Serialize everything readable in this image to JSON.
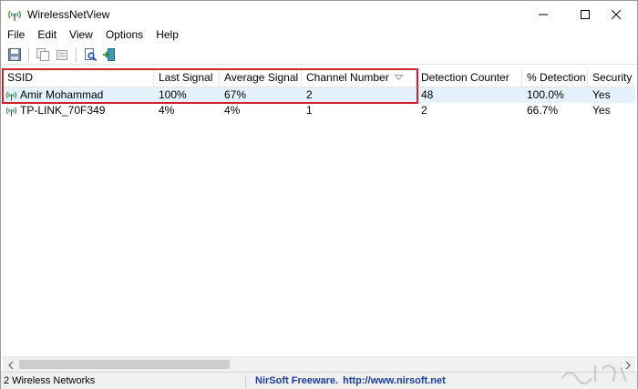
{
  "window": {
    "title": "WirelessNetView",
    "app_icon": "wifi-antenna-icon",
    "controls": [
      "minimize-icon",
      "maximize-icon",
      "close-icon"
    ]
  },
  "menu": {
    "items": [
      {
        "label": "File"
      },
      {
        "label": "Edit"
      },
      {
        "label": "View"
      },
      {
        "label": "Options"
      },
      {
        "label": "Help"
      }
    ]
  },
  "toolbar": {
    "buttons": [
      "save-icon",
      "copy-icon",
      "properties-icon",
      "find-icon",
      "exit-icon"
    ]
  },
  "table": {
    "columns": [
      {
        "label": "SSID"
      },
      {
        "label": "Last Signal"
      },
      {
        "label": "Average Signal"
      },
      {
        "label": "Channel Number"
      },
      {
        "label": "Detection Counter"
      },
      {
        "label": "% Detection"
      },
      {
        "label": "Security En"
      }
    ],
    "sorted_column": "Channel Number",
    "rows": [
      {
        "ssid": "Amir Mohammad",
        "last_signal": "100%",
        "average_signal": "67%",
        "channel": "2",
        "detection_counter": "48",
        "detection_pct": "100.0%",
        "security": "Yes",
        "selected": true
      },
      {
        "ssid": "TP-LINK_70F349",
        "last_signal": "4%",
        "average_signal": "4%",
        "channel": "1",
        "detection_counter": "2",
        "detection_pct": "66.7%",
        "security": "Yes",
        "selected": false
      }
    ]
  },
  "status": {
    "networks": "2 Wireless Networks",
    "credit": "NirSoft Freeware.",
    "url": "http://www.nirsoft.net"
  },
  "colors": {
    "highlight_box": "#d0212e",
    "selected_row": "#e5f1fb",
    "link": "#1b3d9e"
  }
}
